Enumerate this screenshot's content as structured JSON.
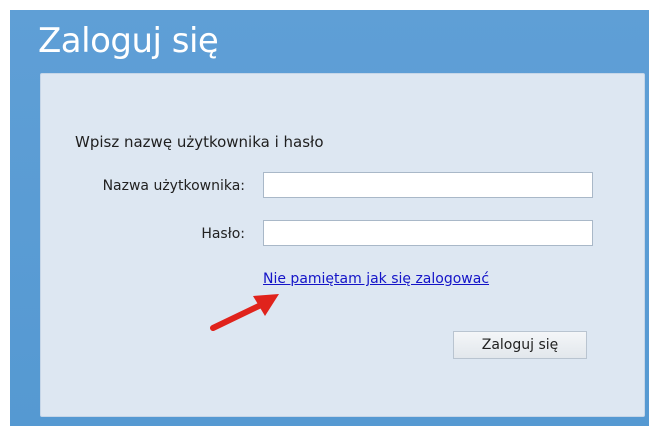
{
  "header": {
    "title": "Zaloguj się"
  },
  "form": {
    "prompt": "Wpisz nazwę użytkownika i hasło",
    "username": {
      "label": "Nazwa użytkownika:",
      "value": "",
      "placeholder": ""
    },
    "password": {
      "label": "Hasło:",
      "value": "",
      "placeholder": ""
    },
    "help_link": "Nie pamiętam jak się zalogować",
    "submit_label": "Zaloguj się"
  },
  "annotation": {
    "icon": "red-arrow-icon",
    "color": "#e0231c"
  },
  "colors": {
    "header_background": "#5b9dd3",
    "panel_background": "#dde7f2",
    "link": "#1414c8"
  }
}
